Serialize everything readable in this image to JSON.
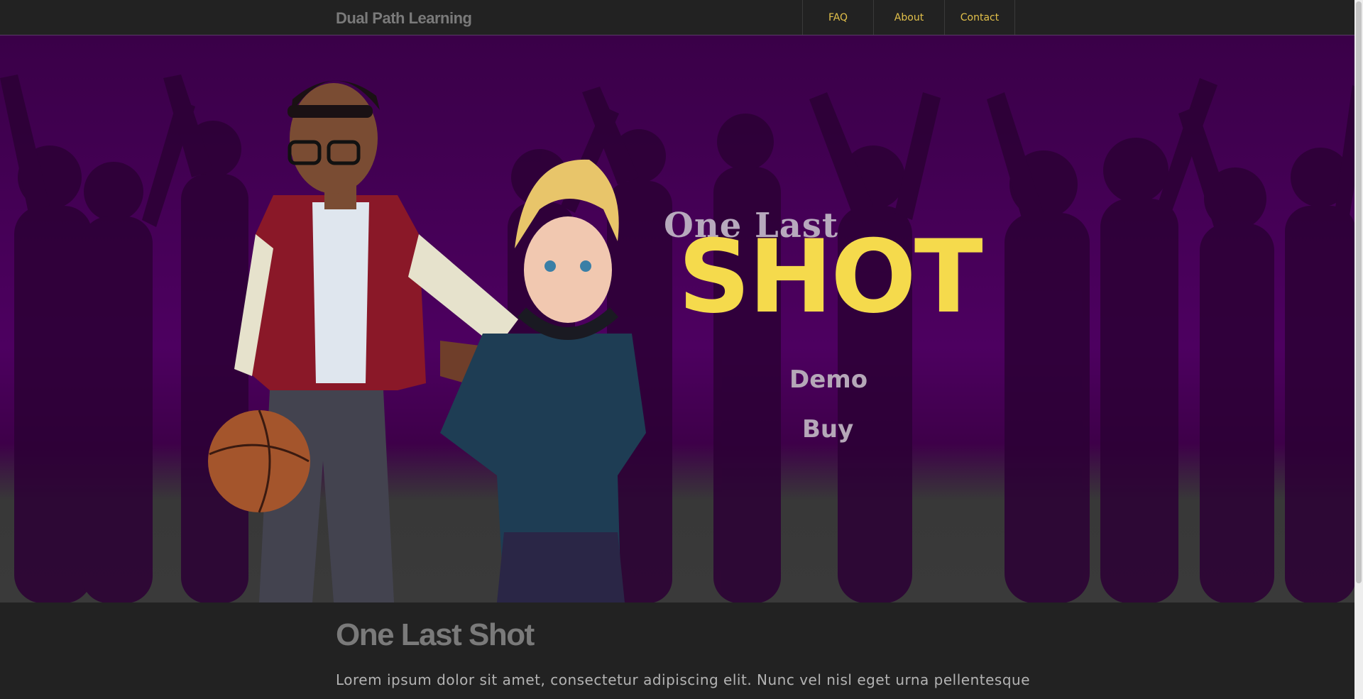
{
  "header": {
    "brand": "Dual Path Learning",
    "nav": [
      {
        "label": "FAQ"
      },
      {
        "label": "About"
      },
      {
        "label": "Contact"
      }
    ]
  },
  "hero": {
    "title_small": "One Last",
    "title_big": "SHOT",
    "demo_label": "Demo",
    "buy_label": "Buy",
    "colors": {
      "accent": "#f5da4c",
      "background": "#4d0060",
      "muted": "#b5a8b8"
    }
  },
  "content": {
    "title": "One Last Shot",
    "text": "Lorem ipsum dolor sit amet, consectetur adipiscing elit. Nunc vel nisl eget urna pellentesque"
  }
}
